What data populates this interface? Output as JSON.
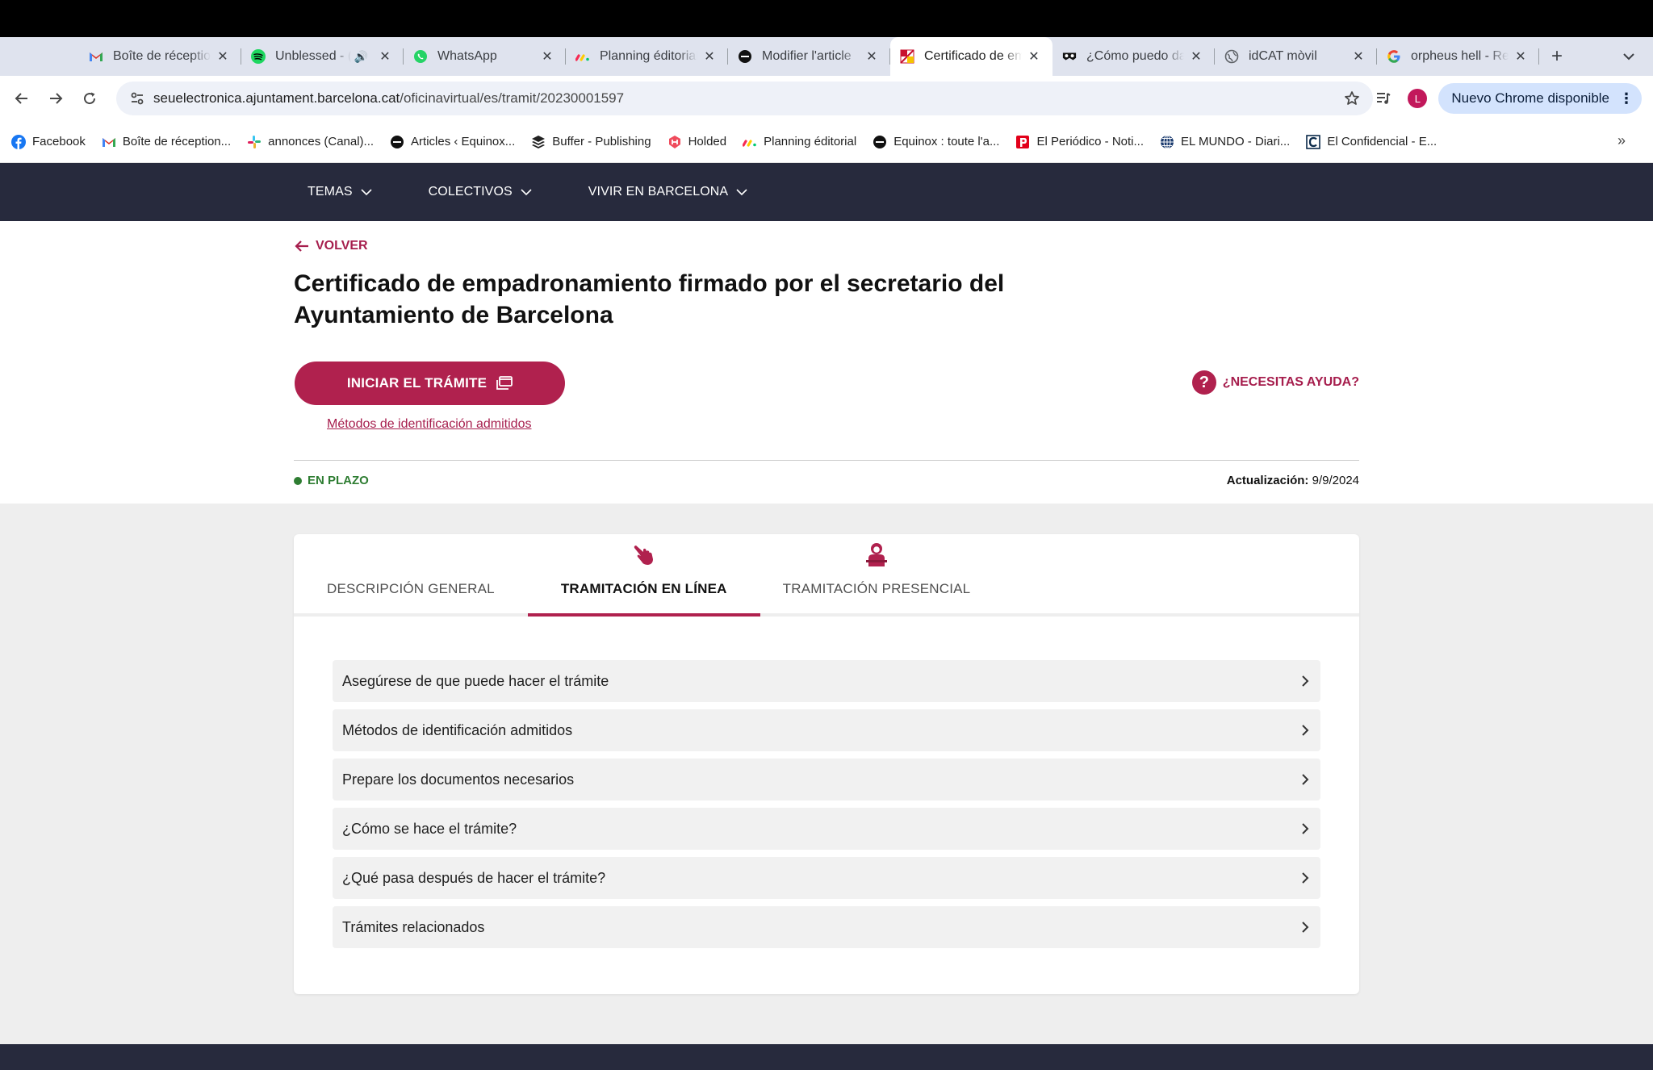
{
  "browser": {
    "tabs": [
      {
        "title": "Boîte de réception",
        "icon": "gmail-icon",
        "active": false
      },
      {
        "title": "Unblessed - (",
        "icon": "spotify-icon",
        "active": false,
        "audio": true
      },
      {
        "title": "WhatsApp",
        "icon": "whatsapp-icon",
        "active": false
      },
      {
        "title": "Planning éditorial",
        "icon": "monday-icon",
        "active": false
      },
      {
        "title": "Modifier l'article",
        "icon": "equinox-icon",
        "active": false
      },
      {
        "title": "Certificado de em",
        "icon": "barcelona-icon",
        "active": true
      },
      {
        "title": "¿Cómo puedo da",
        "icon": "mask-icon",
        "active": false
      },
      {
        "title": "idCAT mòvil",
        "icon": "globe-icon",
        "active": false
      },
      {
        "title": "orpheus hell - Re",
        "icon": "google-icon",
        "active": false
      }
    ],
    "url_domain": "seuelectronica.ajuntament.barcelona.cat",
    "url_path": "/oficinavirtual/es/tramit/20230001597",
    "profile_initial": "L",
    "update_label": "Nuevo Chrome disponible",
    "bookmarks": [
      {
        "label": "Facebook",
        "icon": "facebook-icon"
      },
      {
        "label": "Boîte de réception...",
        "icon": "gmail-icon"
      },
      {
        "label": "annonces (Canal)...",
        "icon": "slack-icon"
      },
      {
        "label": "Articles ‹ Equinox...",
        "icon": "equinox-icon"
      },
      {
        "label": "Buffer - Publishing",
        "icon": "buffer-icon"
      },
      {
        "label": "Holded",
        "icon": "holded-icon"
      },
      {
        "label": "Planning éditorial",
        "icon": "monday-icon"
      },
      {
        "label": "Equinox : toute l'a...",
        "icon": "equinox-icon"
      },
      {
        "label": "El Periódico - Noti...",
        "icon": "periodico-icon"
      },
      {
        "label": "EL MUNDO - Diari...",
        "icon": "globe-icon"
      },
      {
        "label": "El Confidencial - E...",
        "icon": "confidencial-icon"
      }
    ]
  },
  "sitenav": {
    "items": [
      "TEMAS",
      "COLECTIVOS",
      "VIVIR EN BARCELONA"
    ]
  },
  "hero": {
    "back_label": "VOLVER",
    "title": "Certificado de empadronamiento firmado por el secretario del Ayuntamiento de Barcelona",
    "start_button": "INICIAR EL TRÁMITE",
    "methods_link": "Métodos de identificación admitidos",
    "help_label": "¿NECESITAS AYUDA?",
    "status": "EN PLAZO",
    "update_label": "Actualización:",
    "update_date": "9/9/2024"
  },
  "colors": {
    "accent": "#b0214e",
    "nav_bg": "#272a3d",
    "status_green": "#2e7d32"
  },
  "content": {
    "tabs": [
      {
        "label": "DESCRIPCIÓN GENERAL",
        "active": false
      },
      {
        "label": "TRAMITACIÓN EN LÍNEA",
        "active": true,
        "icon": "hand-pointer-icon"
      },
      {
        "label": "TRAMITACIÓN PRESENCIAL",
        "active": false,
        "icon": "person-desk-icon"
      }
    ],
    "accordion": [
      "Asegúrese de que puede hacer el trámite",
      "Métodos de identificación admitidos",
      "Prepare los documentos necesarios",
      "¿Cómo se hace el trámite?",
      "¿Qué pasa después de hacer el trámite?",
      "Trámites relacionados"
    ]
  }
}
